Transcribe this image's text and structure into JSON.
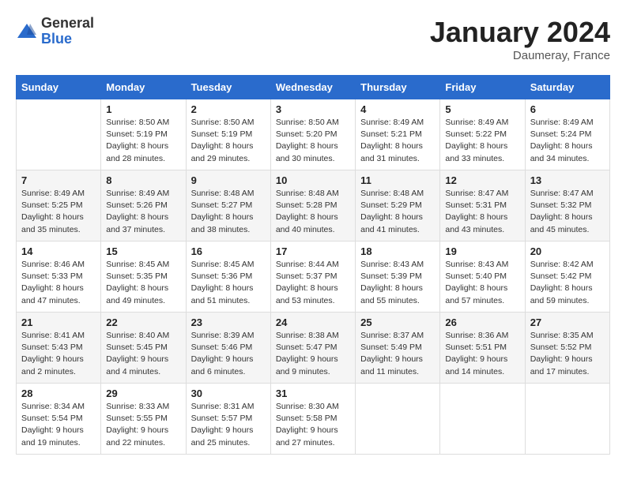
{
  "header": {
    "logo_general": "General",
    "logo_blue": "Blue",
    "month_title": "January 2024",
    "location": "Daumeray, France"
  },
  "days_of_week": [
    "Sunday",
    "Monday",
    "Tuesday",
    "Wednesday",
    "Thursday",
    "Friday",
    "Saturday"
  ],
  "weeks": [
    [
      {
        "day": "",
        "info": ""
      },
      {
        "day": "1",
        "info": "Sunrise: 8:50 AM\nSunset: 5:19 PM\nDaylight: 8 hours\nand 28 minutes."
      },
      {
        "day": "2",
        "info": "Sunrise: 8:50 AM\nSunset: 5:19 PM\nDaylight: 8 hours\nand 29 minutes."
      },
      {
        "day": "3",
        "info": "Sunrise: 8:50 AM\nSunset: 5:20 PM\nDaylight: 8 hours\nand 30 minutes."
      },
      {
        "day": "4",
        "info": "Sunrise: 8:49 AM\nSunset: 5:21 PM\nDaylight: 8 hours\nand 31 minutes."
      },
      {
        "day": "5",
        "info": "Sunrise: 8:49 AM\nSunset: 5:22 PM\nDaylight: 8 hours\nand 33 minutes."
      },
      {
        "day": "6",
        "info": "Sunrise: 8:49 AM\nSunset: 5:24 PM\nDaylight: 8 hours\nand 34 minutes."
      }
    ],
    [
      {
        "day": "7",
        "info": "Sunrise: 8:49 AM\nSunset: 5:25 PM\nDaylight: 8 hours\nand 35 minutes."
      },
      {
        "day": "8",
        "info": "Sunrise: 8:49 AM\nSunset: 5:26 PM\nDaylight: 8 hours\nand 37 minutes."
      },
      {
        "day": "9",
        "info": "Sunrise: 8:48 AM\nSunset: 5:27 PM\nDaylight: 8 hours\nand 38 minutes."
      },
      {
        "day": "10",
        "info": "Sunrise: 8:48 AM\nSunset: 5:28 PM\nDaylight: 8 hours\nand 40 minutes."
      },
      {
        "day": "11",
        "info": "Sunrise: 8:48 AM\nSunset: 5:29 PM\nDaylight: 8 hours\nand 41 minutes."
      },
      {
        "day": "12",
        "info": "Sunrise: 8:47 AM\nSunset: 5:31 PM\nDaylight: 8 hours\nand 43 minutes."
      },
      {
        "day": "13",
        "info": "Sunrise: 8:47 AM\nSunset: 5:32 PM\nDaylight: 8 hours\nand 45 minutes."
      }
    ],
    [
      {
        "day": "14",
        "info": "Sunrise: 8:46 AM\nSunset: 5:33 PM\nDaylight: 8 hours\nand 47 minutes."
      },
      {
        "day": "15",
        "info": "Sunrise: 8:45 AM\nSunset: 5:35 PM\nDaylight: 8 hours\nand 49 minutes."
      },
      {
        "day": "16",
        "info": "Sunrise: 8:45 AM\nSunset: 5:36 PM\nDaylight: 8 hours\nand 51 minutes."
      },
      {
        "day": "17",
        "info": "Sunrise: 8:44 AM\nSunset: 5:37 PM\nDaylight: 8 hours\nand 53 minutes."
      },
      {
        "day": "18",
        "info": "Sunrise: 8:43 AM\nSunset: 5:39 PM\nDaylight: 8 hours\nand 55 minutes."
      },
      {
        "day": "19",
        "info": "Sunrise: 8:43 AM\nSunset: 5:40 PM\nDaylight: 8 hours\nand 57 minutes."
      },
      {
        "day": "20",
        "info": "Sunrise: 8:42 AM\nSunset: 5:42 PM\nDaylight: 8 hours\nand 59 minutes."
      }
    ],
    [
      {
        "day": "21",
        "info": "Sunrise: 8:41 AM\nSunset: 5:43 PM\nDaylight: 9 hours\nand 2 minutes."
      },
      {
        "day": "22",
        "info": "Sunrise: 8:40 AM\nSunset: 5:45 PM\nDaylight: 9 hours\nand 4 minutes."
      },
      {
        "day": "23",
        "info": "Sunrise: 8:39 AM\nSunset: 5:46 PM\nDaylight: 9 hours\nand 6 minutes."
      },
      {
        "day": "24",
        "info": "Sunrise: 8:38 AM\nSunset: 5:47 PM\nDaylight: 9 hours\nand 9 minutes."
      },
      {
        "day": "25",
        "info": "Sunrise: 8:37 AM\nSunset: 5:49 PM\nDaylight: 9 hours\nand 11 minutes."
      },
      {
        "day": "26",
        "info": "Sunrise: 8:36 AM\nSunset: 5:51 PM\nDaylight: 9 hours\nand 14 minutes."
      },
      {
        "day": "27",
        "info": "Sunrise: 8:35 AM\nSunset: 5:52 PM\nDaylight: 9 hours\nand 17 minutes."
      }
    ],
    [
      {
        "day": "28",
        "info": "Sunrise: 8:34 AM\nSunset: 5:54 PM\nDaylight: 9 hours\nand 19 minutes."
      },
      {
        "day": "29",
        "info": "Sunrise: 8:33 AM\nSunset: 5:55 PM\nDaylight: 9 hours\nand 22 minutes."
      },
      {
        "day": "30",
        "info": "Sunrise: 8:31 AM\nSunset: 5:57 PM\nDaylight: 9 hours\nand 25 minutes."
      },
      {
        "day": "31",
        "info": "Sunrise: 8:30 AM\nSunset: 5:58 PM\nDaylight: 9 hours\nand 27 minutes."
      },
      {
        "day": "",
        "info": ""
      },
      {
        "day": "",
        "info": ""
      },
      {
        "day": "",
        "info": ""
      }
    ]
  ]
}
